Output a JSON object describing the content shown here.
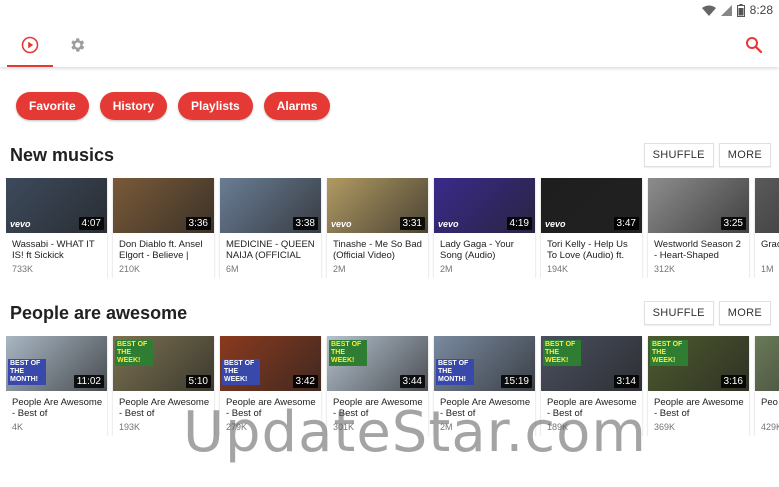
{
  "status_bar": {
    "time": "8:28"
  },
  "toolbar": {
    "tabs": [
      {
        "name": "play"
      },
      {
        "name": "settings"
      }
    ]
  },
  "chips": [
    "Favorite",
    "History",
    "Playlists",
    "Alarms"
  ],
  "sections": [
    {
      "title": "New musics",
      "shuffle_label": "SHUFFLE",
      "more_label": "MORE",
      "videos": [
        {
          "title": "Wassabi - WHAT IT IS! ft Sickick",
          "views": "733K",
          "duration": "4:07",
          "vevo": "vevo",
          "color": "#3d4a5c"
        },
        {
          "title": "Don Diablo ft. Ansel Elgort - Believe |",
          "views": "210K",
          "duration": "3:36",
          "vevo": "",
          "color": "#7a5a38"
        },
        {
          "title": "MEDICINE - QUEEN NAIJA (OFFICIAL",
          "views": "6M",
          "duration": "3:38",
          "vevo": "",
          "color": "#6a7d95"
        },
        {
          "title": "Tinashe - Me So Bad (Official Video)",
          "views": "2M",
          "duration": "3:31",
          "vevo": "vevo",
          "color": "#b19a63"
        },
        {
          "title": "Lady Gaga - Your Song (Audio)",
          "views": "2M",
          "duration": "4:19",
          "vevo": "vevo",
          "color": "#3a2a8c"
        },
        {
          "title": "Tori Kelly - Help Us To Love (Audio) ft.",
          "views": "194K",
          "duration": "3:47",
          "vevo": "vevo",
          "color": "#1e1e1e"
        },
        {
          "title": "Westworld Season 2 - Heart-Shaped",
          "views": "312K",
          "duration": "3:25",
          "vevo": "",
          "color": "#8d8d8d"
        },
        {
          "title": "Grac Clea",
          "views": "1M",
          "duration": "",
          "vevo": "",
          "color": "#5a5a5a"
        }
      ]
    },
    {
      "title": "People are awesome",
      "shuffle_label": "SHUFFLE",
      "more_label": "MORE",
      "videos": [
        {
          "title": "People Are Awesome - Best of",
          "views": "4K",
          "duration": "11:02",
          "badge": "BEST OF THE MONTH!",
          "badge_style": "bottom",
          "color": "#a9b7c4"
        },
        {
          "title": "People Are Awesome - Best of",
          "views": "193K",
          "duration": "5:10",
          "badge": "BEST OF THE WEEK!",
          "badge_style": "top",
          "color": "#7c7250"
        },
        {
          "title": "People are Awesome - Best of",
          "views": "279K",
          "duration": "3:42",
          "badge": "BEST OF THE WEEK!",
          "badge_style": "bottom",
          "color": "#8a3a1e"
        },
        {
          "title": "People are Awesome - Best of",
          "views": "301K",
          "duration": "3:44",
          "badge": "BEST OF THE WEEK!",
          "badge_style": "top",
          "color": "#b4c1cf"
        },
        {
          "title": "People Are Awesome - Best of",
          "views": "2M",
          "duration": "15:19",
          "badge": "BEST OF THE MONTH!",
          "badge_style": "bottom",
          "color": "#7a8aa0"
        },
        {
          "title": "People are Awesome - Best of",
          "views": "189K",
          "duration": "3:14",
          "badge": "BEST OF THE WEEK!",
          "badge_style": "top",
          "color": "#4a5060"
        },
        {
          "title": "People are Awesome - Best of",
          "views": "369K",
          "duration": "3:16",
          "badge": "BEST OF THE WEEK!",
          "badge_style": "top",
          "color": "#4e5a2e"
        },
        {
          "title": "Peo Awe",
          "views": "429K",
          "duration": "",
          "badge": "",
          "badge_style": "",
          "color": "#6a7a58"
        }
      ]
    }
  ],
  "watermark": "UpdateStar.com",
  "colors": {
    "accent": "#e53935"
  }
}
